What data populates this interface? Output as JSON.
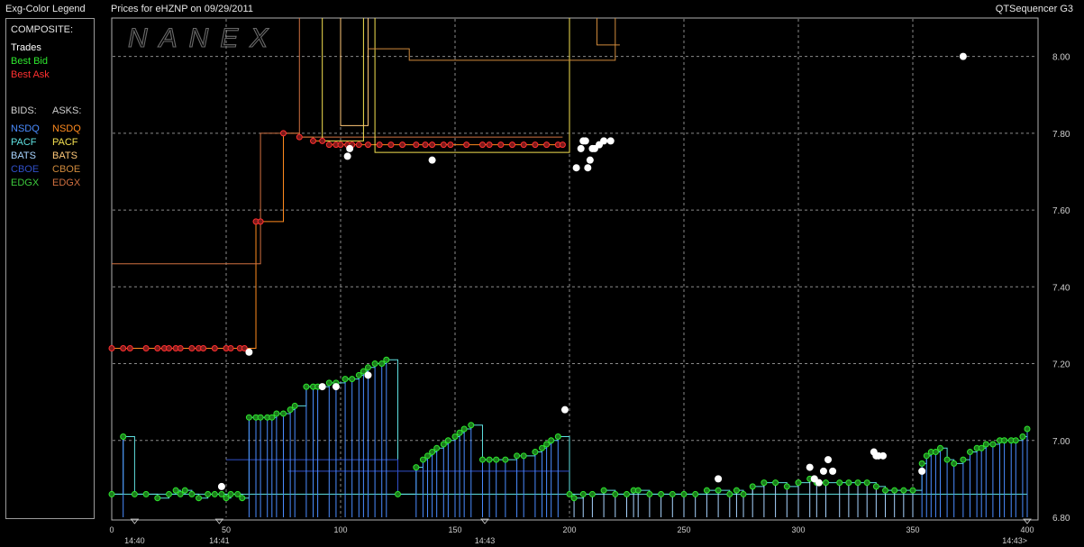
{
  "header": {
    "legend_title": "Exg-Color Legend",
    "chart_title": "Prices for  eHZNP  on  09/29/2011",
    "app_name": "QTSequencer G3"
  },
  "legend": {
    "composite_label": "COMPOSITE:",
    "trades_label": "Trades",
    "best_bid_label": "Best Bid",
    "best_ask_label": "Best Ask",
    "bids_label": "BIDS:",
    "asks_label": "ASKS:",
    "exchanges": [
      {
        "bid": "NSDQ",
        "ask": "NSDQ",
        "bid_color": "#4a8cff",
        "ask_color": "#ff8a1e"
      },
      {
        "bid": "PACF",
        "ask": "PACF",
        "bid_color": "#5fe0e0",
        "ask_color": "#f4e050"
      },
      {
        "bid": "BATS",
        "ask": "BATS",
        "bid_color": "#a8d4ff",
        "ask_color": "#ffc878"
      },
      {
        "bid": "CBOE",
        "ask": "CBOE",
        "bid_color": "#3050c8",
        "ask_color": "#d08a3c"
      },
      {
        "bid": "EDGX",
        "ask": "EDGX",
        "bid_color": "#3cc83c",
        "ask_color": "#d07040"
      }
    ],
    "trades_color": "#ffffff",
    "best_bid_color": "#2ee82e",
    "best_ask_color": "#ff3030"
  },
  "chart_data": {
    "type": "line",
    "watermark": "NANEX",
    "xlim": [
      0,
      400
    ],
    "ylim": [
      6.8,
      8.1
    ],
    "x_ticks": [
      0,
      50,
      100,
      150,
      200,
      250,
      300,
      350,
      400
    ],
    "y_ticks": [
      "8.00",
      "7.80",
      "7.60",
      "7.40",
      "7.20",
      "7.00",
      "6.80"
    ],
    "time_labels": [
      {
        "x": 10,
        "text": "14:40"
      },
      {
        "x": 47,
        "text": "14:41"
      },
      {
        "x": 163,
        "text": "14:43"
      },
      {
        "x": 400,
        "text": "14:43>"
      }
    ],
    "grid": true,
    "series": [
      {
        "name": "Best Ask",
        "color": "#ff3030",
        "points": [
          [
            0,
            7.24
          ],
          [
            5,
            7.24
          ],
          [
            8,
            7.24
          ],
          [
            15,
            7.24
          ],
          [
            20,
            7.24
          ],
          [
            23,
            7.24
          ],
          [
            25,
            7.24
          ],
          [
            28,
            7.24
          ],
          [
            30,
            7.24
          ],
          [
            35,
            7.24
          ],
          [
            38,
            7.24
          ],
          [
            40,
            7.24
          ],
          [
            45,
            7.24
          ],
          [
            50,
            7.24
          ],
          [
            52,
            7.24
          ],
          [
            56,
            7.24
          ],
          [
            58,
            7.24
          ],
          [
            63,
            7.57
          ],
          [
            65,
            7.57
          ],
          [
            75,
            7.8
          ],
          [
            82,
            7.79
          ],
          [
            88,
            7.78
          ],
          [
            92,
            7.78
          ],
          [
            95,
            7.77
          ],
          [
            98,
            7.77
          ],
          [
            100,
            7.77
          ],
          [
            103,
            7.77
          ],
          [
            105,
            7.77
          ],
          [
            108,
            7.77
          ],
          [
            112,
            7.77
          ],
          [
            117,
            7.77
          ],
          [
            122,
            7.77
          ],
          [
            127,
            7.77
          ],
          [
            133,
            7.77
          ],
          [
            137,
            7.77
          ],
          [
            140,
            7.77
          ],
          [
            145,
            7.77
          ],
          [
            148,
            7.77
          ],
          [
            155,
            7.77
          ],
          [
            162,
            7.77
          ],
          [
            165,
            7.77
          ],
          [
            170,
            7.77
          ],
          [
            175,
            7.77
          ],
          [
            180,
            7.77
          ],
          [
            185,
            7.77
          ],
          [
            190,
            7.77
          ],
          [
            195,
            7.77
          ],
          [
            197,
            7.77
          ]
        ]
      },
      {
        "name": "Best Bid",
        "color": "#2ee82e",
        "points": [
          [
            0,
            6.86
          ],
          [
            5,
            7.01
          ],
          [
            10,
            6.86
          ],
          [
            15,
            6.86
          ],
          [
            20,
            6.85
          ],
          [
            25,
            6.86
          ],
          [
            28,
            6.87
          ],
          [
            30,
            6.86
          ],
          [
            32,
            6.87
          ],
          [
            35,
            6.86
          ],
          [
            38,
            6.85
          ],
          [
            42,
            6.86
          ],
          [
            45,
            6.86
          ],
          [
            48,
            6.86
          ],
          [
            50,
            6.85
          ],
          [
            52,
            6.86
          ],
          [
            55,
            6.86
          ],
          [
            57,
            6.85
          ],
          [
            60,
            7.06
          ],
          [
            63,
            7.06
          ],
          [
            65,
            7.06
          ],
          [
            68,
            7.06
          ],
          [
            70,
            7.06
          ],
          [
            72,
            7.07
          ],
          [
            75,
            7.07
          ],
          [
            78,
            7.08
          ],
          [
            80,
            7.09
          ],
          [
            85,
            7.14
          ],
          [
            88,
            7.14
          ],
          [
            90,
            7.14
          ],
          [
            95,
            7.15
          ],
          [
            98,
            7.15
          ],
          [
            102,
            7.16
          ],
          [
            105,
            7.16
          ],
          [
            108,
            7.17
          ],
          [
            110,
            7.18
          ],
          [
            112,
            7.19
          ],
          [
            115,
            7.2
          ],
          [
            118,
            7.2
          ],
          [
            120,
            7.21
          ],
          [
            125,
            6.86
          ],
          [
            133,
            6.93
          ],
          [
            136,
            6.95
          ],
          [
            138,
            6.96
          ],
          [
            140,
            6.97
          ],
          [
            142,
            6.98
          ],
          [
            145,
            6.99
          ],
          [
            147,
            7.0
          ],
          [
            150,
            7.01
          ],
          [
            152,
            7.02
          ],
          [
            154,
            7.03
          ],
          [
            157,
            7.04
          ],
          [
            162,
            6.95
          ],
          [
            165,
            6.95
          ],
          [
            168,
            6.95
          ],
          [
            172,
            6.95
          ],
          [
            177,
            6.96
          ],
          [
            180,
            6.96
          ],
          [
            185,
            6.97
          ],
          [
            188,
            6.98
          ],
          [
            190,
            6.99
          ],
          [
            192,
            7.0
          ],
          [
            195,
            7.01
          ],
          [
            200,
            6.86
          ],
          [
            202,
            6.85
          ],
          [
            206,
            6.86
          ],
          [
            210,
            6.86
          ],
          [
            215,
            6.87
          ],
          [
            220,
            6.86
          ],
          [
            225,
            6.86
          ],
          [
            228,
            6.87
          ],
          [
            230,
            6.87
          ],
          [
            235,
            6.86
          ],
          [
            240,
            6.86
          ],
          [
            245,
            6.86
          ],
          [
            250,
            6.86
          ],
          [
            255,
            6.86
          ],
          [
            260,
            6.87
          ],
          [
            265,
            6.87
          ],
          [
            270,
            6.86
          ],
          [
            273,
            6.87
          ],
          [
            276,
            6.86
          ],
          [
            280,
            6.88
          ],
          [
            285,
            6.89
          ],
          [
            290,
            6.89
          ],
          [
            295,
            6.88
          ],
          [
            300,
            6.89
          ],
          [
            305,
            6.9
          ],
          [
            308,
            6.89
          ],
          [
            312,
            6.89
          ],
          [
            318,
            6.89
          ],
          [
            322,
            6.89
          ],
          [
            326,
            6.89
          ],
          [
            330,
            6.89
          ],
          [
            334,
            6.88
          ],
          [
            338,
            6.87
          ],
          [
            342,
            6.87
          ],
          [
            346,
            6.87
          ],
          [
            350,
            6.87
          ],
          [
            354,
            6.94
          ],
          [
            356,
            6.96
          ],
          [
            358,
            6.97
          ],
          [
            360,
            6.97
          ],
          [
            362,
            6.98
          ],
          [
            365,
            6.95
          ],
          [
            368,
            6.94
          ],
          [
            372,
            6.95
          ],
          [
            375,
            6.97
          ],
          [
            378,
            6.98
          ],
          [
            380,
            6.98
          ],
          [
            382,
            6.99
          ],
          [
            385,
            6.99
          ],
          [
            388,
            7.0
          ],
          [
            390,
            7.0
          ],
          [
            393,
            7.0
          ],
          [
            395,
            7.0
          ],
          [
            398,
            7.01
          ],
          [
            400,
            7.03
          ]
        ]
      },
      {
        "name": "Trades",
        "color": "#ffffff",
        "points": [
          [
            60,
            7.23
          ],
          [
            48,
            6.88
          ],
          [
            92,
            7.14
          ],
          [
            98,
            7.14
          ],
          [
            112,
            7.17
          ],
          [
            103,
            7.74
          ],
          [
            104,
            7.76
          ],
          [
            140,
            7.73
          ],
          [
            198,
            7.08
          ],
          [
            203,
            7.71
          ],
          [
            205,
            7.76
          ],
          [
            206,
            7.78
          ],
          [
            207,
            7.78
          ],
          [
            208,
            7.71
          ],
          [
            209,
            7.73
          ],
          [
            210,
            7.76
          ],
          [
            211,
            7.76
          ],
          [
            213,
            7.77
          ],
          [
            215,
            7.78
          ],
          [
            218,
            7.78
          ],
          [
            265,
            6.9
          ],
          [
            305,
            6.93
          ],
          [
            307,
            6.9
          ],
          [
            309,
            6.89
          ],
          [
            311,
            6.92
          ],
          [
            313,
            6.95
          ],
          [
            315,
            6.92
          ],
          [
            333,
            6.97
          ],
          [
            334,
            6.96
          ],
          [
            335,
            6.96
          ],
          [
            337,
            6.96
          ],
          [
            354,
            6.92
          ],
          [
            372,
            8.0
          ]
        ]
      }
    ]
  }
}
